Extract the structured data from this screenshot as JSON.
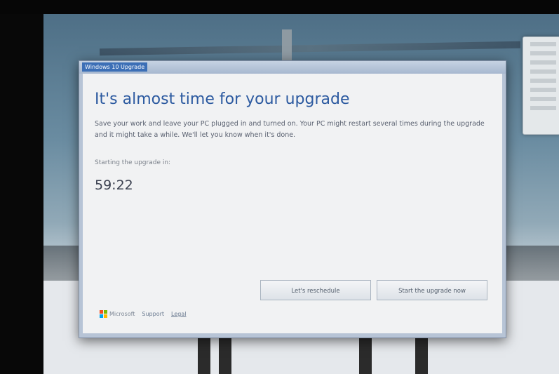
{
  "dialog": {
    "window_title": "Windows 10 Upgrade",
    "heading": "It's almost time for your upgrade",
    "body": "Save your work and leave your PC plugged in and turned on. Your PC might restart several times during the upgrade and it might take a while. We'll let you know when it's done.",
    "countdown_label": "Starting the upgrade in:",
    "countdown_value": "59:22",
    "buttons": {
      "reschedule": "Let's reschedule",
      "start_now": "Start the upgrade now"
    },
    "footer": {
      "brand": "Microsoft",
      "support": "Support",
      "legal": "Legal"
    }
  },
  "colors": {
    "accent": "#2c5aa0",
    "dialog_background": "#f1f2f3",
    "title_bar": "#3c6fb6"
  }
}
